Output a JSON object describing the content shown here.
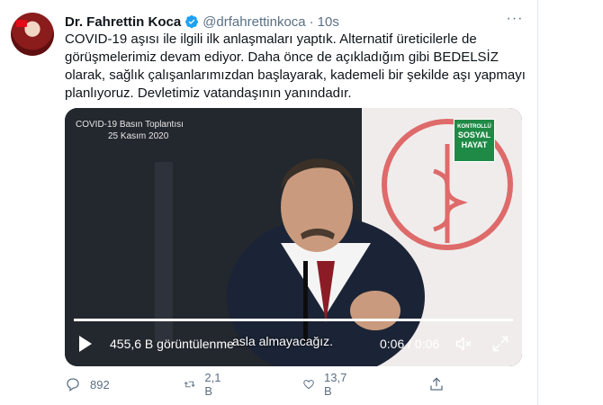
{
  "tweet": {
    "author_name": "Dr. Fahrettin Koca",
    "handle": "@drfahrettinkoca",
    "separator": "·",
    "time": "10s",
    "more": "···",
    "text_lines": [
      "COVID-19 aşısı ile ilgili ilk anlaşmaları yaptık. Alternatif üreticilerle de",
      "görüşmelerimiz devam ediyor. Daha önce de açıkladığım gibi BEDELSİZ",
      "olarak, sağlık çalışanlarımızdan başlayarak, kademeli bir şekilde aşı yapmayı",
      "planlıyoruz. Devletimiz vatandaşının yanındadır."
    ]
  },
  "video": {
    "overlay_title": "COVID-19 Basın Toplantısı",
    "overlay_date": "25 Kasım 2020",
    "badge_top": "KONTROLLÜ",
    "badge_l1": "SOSYAL",
    "badge_l2": "HAYAT",
    "subtitle": "asla almayacağız.",
    "views": "455,6 B görüntülenme",
    "duration": "0:06 / 0:06",
    "progress_fraction": 1.0
  },
  "actions": {
    "replies": "892",
    "retweets": "2,1 B",
    "likes": "13,7 B"
  },
  "colors": {
    "verified": "#1da1f2",
    "muted_text": "#5b7083",
    "badge": "#1f8a46"
  }
}
